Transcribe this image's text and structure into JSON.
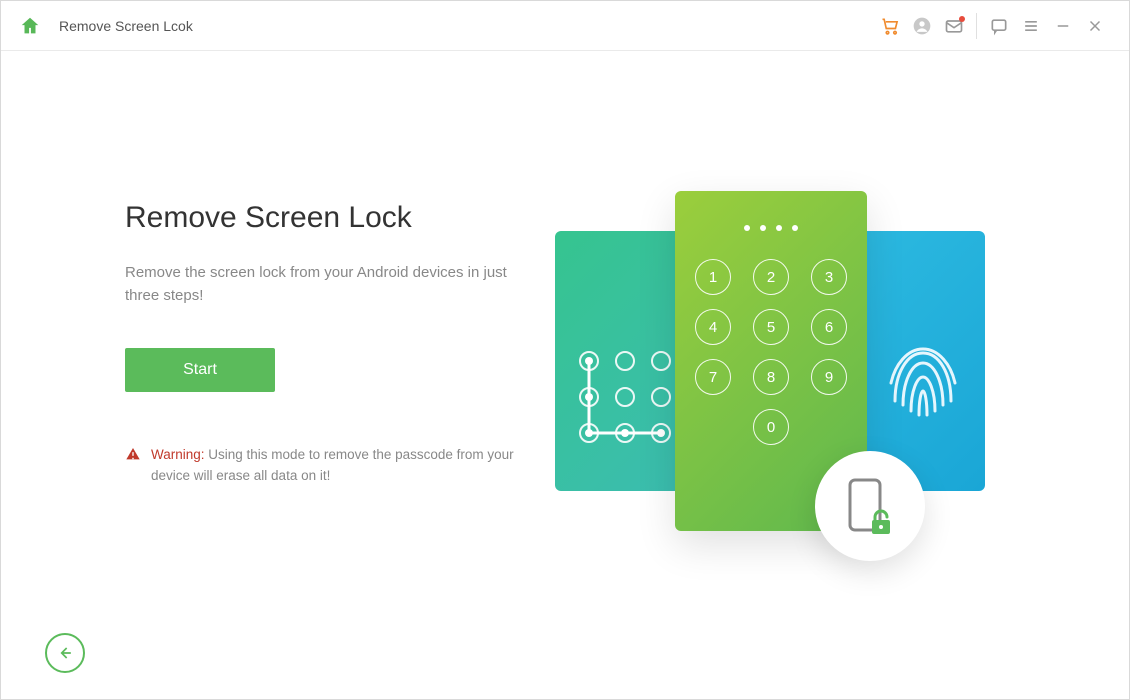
{
  "window_title": "Remove Screen Lcok",
  "heading": "Remove Screen Lock",
  "subtext": "Remove the screen lock from your Android devices in just three steps!",
  "start_label": "Start",
  "warning_label": "Warning:",
  "warning_text": " Using this mode to remove the passcode from your device will erase all data on it!",
  "keypad": {
    "digits": [
      "1",
      "2",
      "3",
      "4",
      "5",
      "6",
      "7",
      "8",
      "9",
      "0"
    ],
    "pin_length": 4
  },
  "colors": {
    "accent": "#5bbb5b",
    "warn": "#c0392b",
    "cart": "#f08b2e"
  }
}
